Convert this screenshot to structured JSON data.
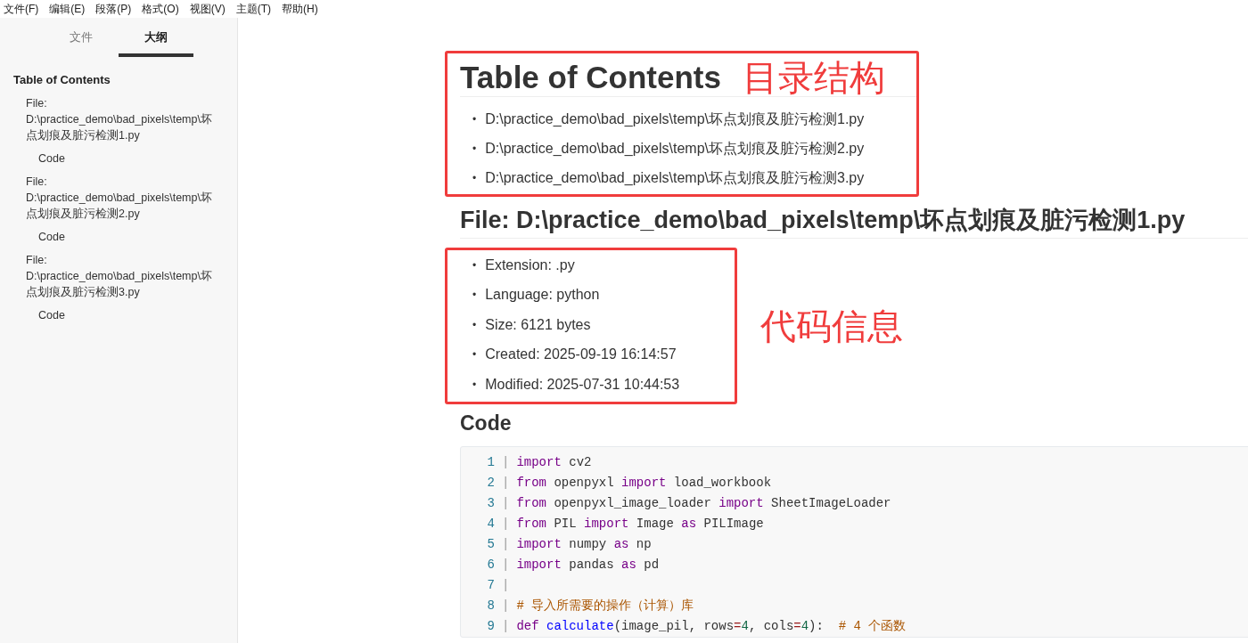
{
  "menu": [
    "文件(F)",
    "编辑(E)",
    "段落(P)",
    "格式(O)",
    "视图(V)",
    "主题(T)",
    "帮助(H)"
  ],
  "sidebar": {
    "tabs": [
      {
        "label": "文件",
        "selected": false
      },
      {
        "label": "大纲",
        "selected": true
      }
    ],
    "outline": {
      "title": "Table of Contents",
      "children": [
        {
          "label": "File: D:\\practice_demo\\bad_pixels\\temp\\坏点划痕及脏污检测1.py",
          "children": [
            {
              "label": "Code"
            }
          ]
        },
        {
          "label": "File: D:\\practice_demo\\bad_pixels\\temp\\坏点划痕及脏污检测2.py",
          "children": [
            {
              "label": "Code"
            }
          ]
        },
        {
          "label": "File: D:\\practice_demo\\bad_pixels\\temp\\坏点划痕及脏污检测3.py",
          "children": [
            {
              "label": "Code"
            }
          ]
        }
      ]
    }
  },
  "document": {
    "toc": {
      "title": "Table of Contents",
      "annotation": "目录结构",
      "items": [
        {
          "bullet": "•",
          "text": "D:\\practice_demo\\bad_pixels\\temp\\坏点划痕及脏污检测1.py"
        },
        {
          "bullet": "•",
          "text": "D:\\practice_demo\\bad_pixels\\temp\\坏点划痕及脏污检测2.py"
        },
        {
          "bullet": "•",
          "text": "D:\\practice_demo\\bad_pixels\\temp\\坏点划痕及脏污检测3.py"
        }
      ]
    },
    "file_heading": "File: D:\\practice_demo\\bad_pixels\\temp\\坏点划痕及脏污检测1.py",
    "info": {
      "annotation": "代码信息",
      "items": [
        {
          "bullet": "•",
          "text": "Extension: .py"
        },
        {
          "bullet": "•",
          "text": "Language: python"
        },
        {
          "bullet": "•",
          "text": "Size: 6121 bytes"
        },
        {
          "bullet": "•",
          "text": "Created: 2025-09-19 16:14:57"
        },
        {
          "bullet": "•",
          "text": "Modified: 2025-07-31 10:44:53"
        }
      ]
    },
    "code_heading": "Code",
    "code_lines": [
      {
        "number": "1",
        "gutter": "|",
        "tokens": [
          {
            "kind": "keyword",
            "text": "import"
          },
          {
            "kind": "plain",
            "text": " cv2"
          }
        ]
      },
      {
        "number": "2",
        "gutter": "|",
        "tokens": [
          {
            "kind": "keyword",
            "text": "from"
          },
          {
            "kind": "plain",
            "text": " openpyxl "
          },
          {
            "kind": "keyword",
            "text": "import"
          },
          {
            "kind": "plain",
            "text": " load_workbook"
          }
        ]
      },
      {
        "number": "3",
        "gutter": "|",
        "tokens": [
          {
            "kind": "keyword",
            "text": "from"
          },
          {
            "kind": "plain",
            "text": " openpyxl_image_loader "
          },
          {
            "kind": "keyword",
            "text": "import"
          },
          {
            "kind": "plain",
            "text": " SheetImageLoader"
          }
        ]
      },
      {
        "number": "4",
        "gutter": "|",
        "tokens": [
          {
            "kind": "keyword",
            "text": "from"
          },
          {
            "kind": "plain",
            "text": " PIL "
          },
          {
            "kind": "keyword",
            "text": "import"
          },
          {
            "kind": "plain",
            "text": " Image "
          },
          {
            "kind": "keyword",
            "text": "as"
          },
          {
            "kind": "plain",
            "text": " PILImage"
          }
        ]
      },
      {
        "number": "5",
        "gutter": "|",
        "tokens": [
          {
            "kind": "keyword",
            "text": "import"
          },
          {
            "kind": "plain",
            "text": " numpy "
          },
          {
            "kind": "keyword",
            "text": "as"
          },
          {
            "kind": "plain",
            "text": " np"
          }
        ]
      },
      {
        "number": "6",
        "gutter": "|",
        "tokens": [
          {
            "kind": "keyword",
            "text": "import"
          },
          {
            "kind": "plain",
            "text": " pandas "
          },
          {
            "kind": "keyword",
            "text": "as"
          },
          {
            "kind": "plain",
            "text": " pd"
          }
        ]
      },
      {
        "number": "7",
        "gutter": "|"
      },
      {
        "number": "8",
        "gutter": "|",
        "tokens": [
          {
            "kind": "comment",
            "text": "# 导入所需要的操作（计算）库"
          }
        ]
      },
      {
        "number": "9",
        "gutter": "|",
        "tokens": [
          {
            "kind": "keyword",
            "text": "def "
          },
          {
            "kind": "function",
            "text": "calculate"
          },
          {
            "kind": "plain",
            "text": "(image_pil, rows"
          },
          {
            "kind": "operator",
            "text": "="
          },
          {
            "kind": "number",
            "text": "4"
          },
          {
            "kind": "plain",
            "text": ", cols"
          },
          {
            "kind": "operator",
            "text": "="
          },
          {
            "kind": "number",
            "text": "4"
          },
          {
            "kind": "plain",
            "text": "):  "
          },
          {
            "kind": "comment",
            "text": "# 4 个函数"
          }
        ]
      }
    ]
  }
}
